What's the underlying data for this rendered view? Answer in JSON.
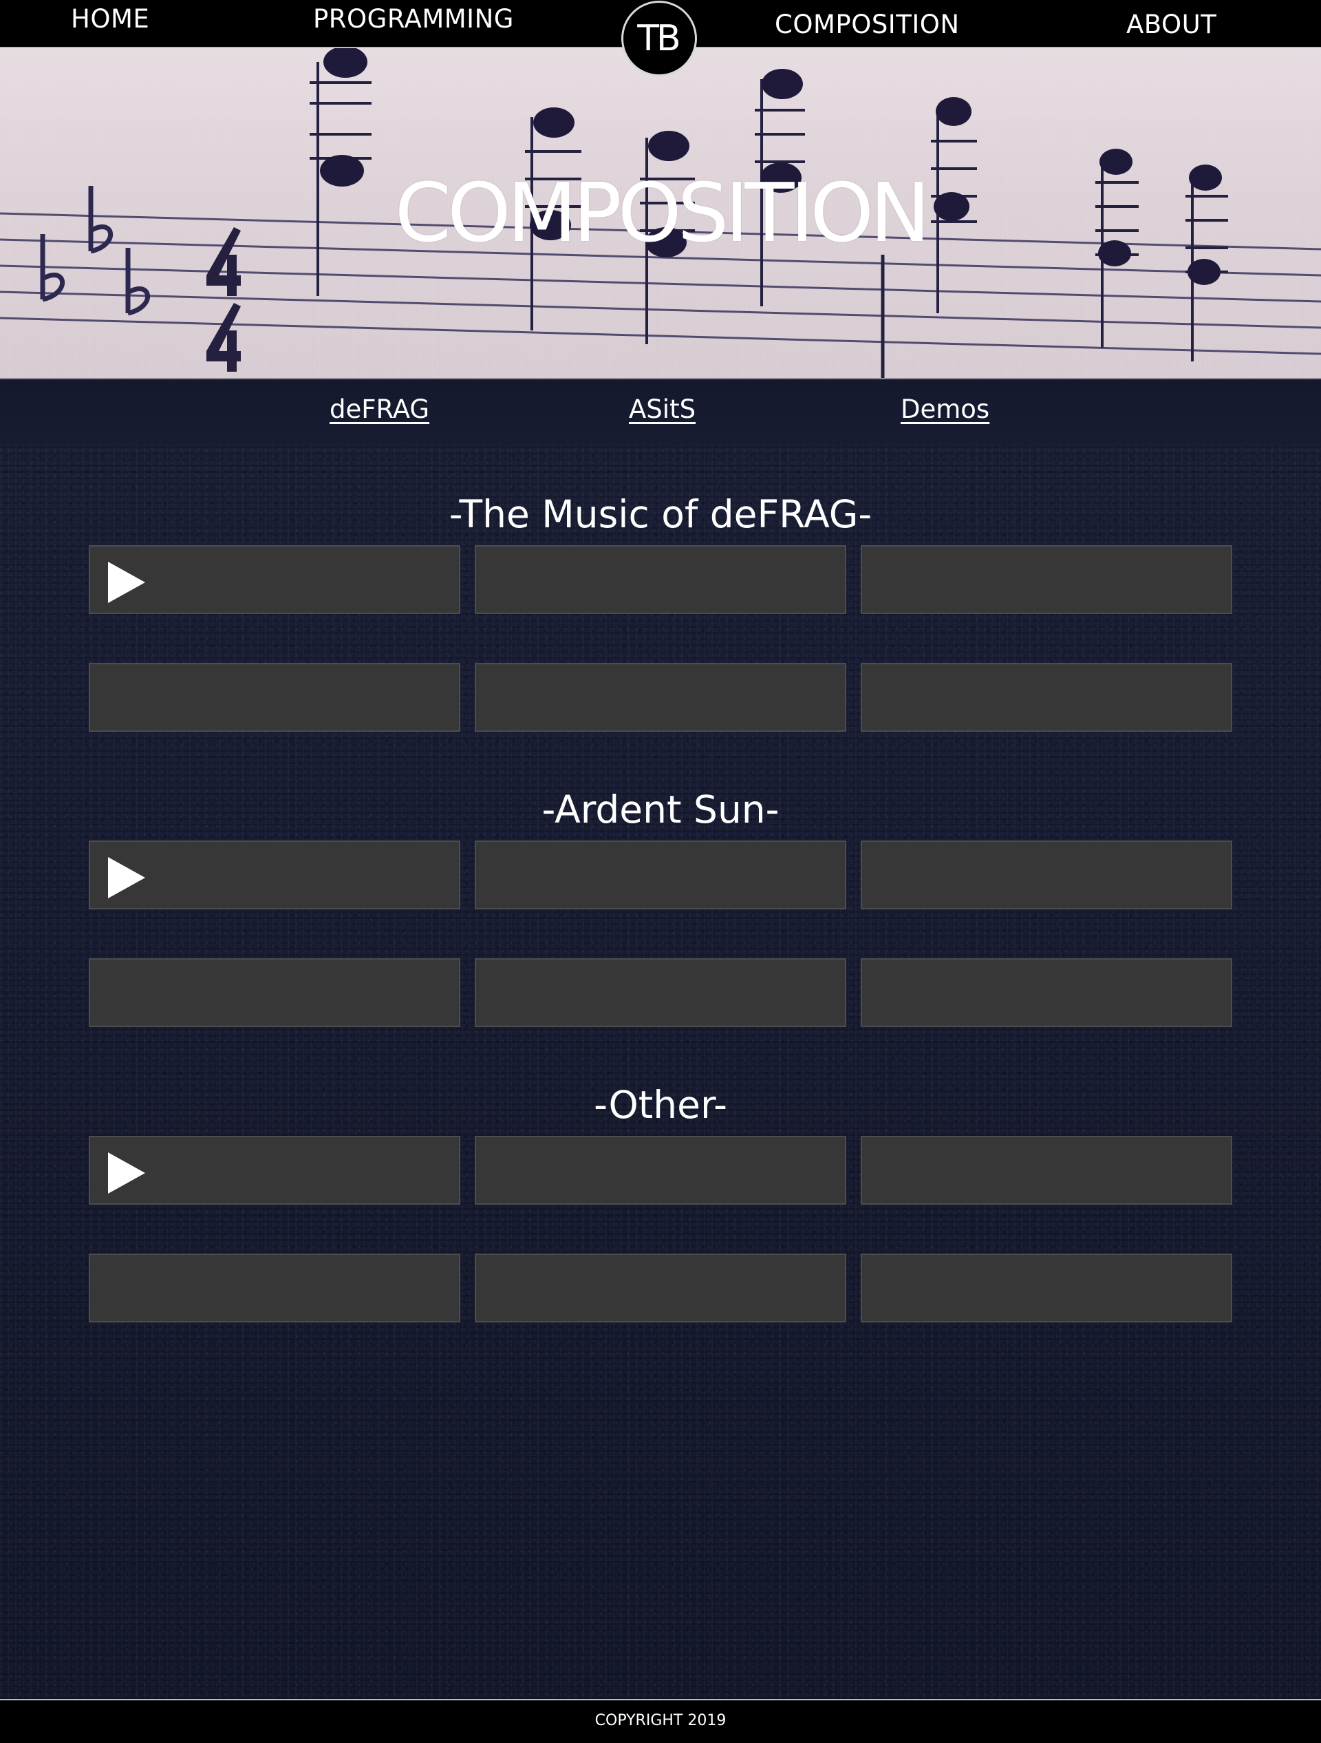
{
  "nav": {
    "home": "HOME",
    "programming": "PROGRAMMING",
    "logo": "TB",
    "composition": "COMPOSITION",
    "about": "ABOUT"
  },
  "hero": {
    "title": "COMPOSITION"
  },
  "subnav": {
    "defrag": "deFRAG",
    "asits": "ASitS",
    "demos": "Demos"
  },
  "sections": [
    {
      "title": "-The Music of deFRAG-"
    },
    {
      "title": "-Ardent Sun-"
    },
    {
      "title": "-Other-"
    }
  ],
  "icons": {
    "play": "play-icon"
  },
  "colors": {
    "nav_bg": "#000000",
    "player_bg": "#373737",
    "page_bg": "#171b30",
    "text": "#ffffff"
  },
  "footer": {
    "text": "COPYRIGHT 2019"
  }
}
